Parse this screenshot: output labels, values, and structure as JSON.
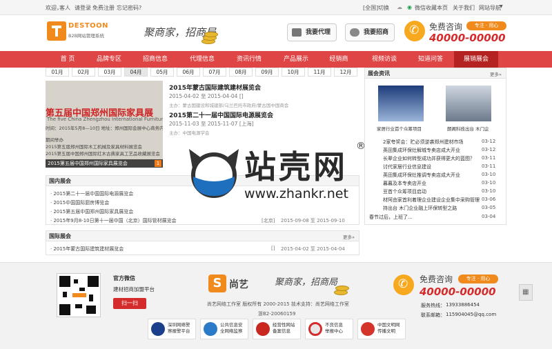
{
  "topbar": {
    "welcome": "欢迎，",
    "guest": "客人",
    "login": "请登录",
    "register": "免费注册",
    "forgot": "忘记密码?",
    "region": "[全国]",
    "switch": "切换",
    "weixin": "微信",
    "favorite": "收藏本页",
    "about": "关于我们",
    "sitenav": "网站导航"
  },
  "header": {
    "logo_text": "DESTOON",
    "logo_sub": "B2B网站管理系统",
    "slogan": "聚商家，招商局",
    "btn_agent": "我要代理",
    "btn_invite": "我要招商",
    "hotline_label": "免费咨询",
    "hotline_tag": "专注 · 用心",
    "hotline_number": "40000-00000"
  },
  "nav": {
    "items": [
      "首 页",
      "品牌专区",
      "招商信息",
      "代理信息",
      "资讯行情",
      "产品展示",
      "经销商",
      "视频访谈",
      "知道问答",
      "展销展会"
    ]
  },
  "months": [
    "01月",
    "02月",
    "03月",
    "04月",
    "05月",
    "06月",
    "07月",
    "08月",
    "09月",
    "10月",
    "11月",
    "12月"
  ],
  "slide": {
    "headline": "第五届中国郑州国际家具展",
    "english": "The five China Zhengzhou International Furniture",
    "line1": "时间：2015年5月8—10日  地址：郑州国际会展中心商务内",
    "line2": "期间举办",
    "line3": "2015第五届郑州国际木工机械及家具材料展览会",
    "line4": "2015第五届中国郑州国际红木古典家具工艺品收藏展览会",
    "caption": "2015第五届中国郑州国际家具展览会",
    "page": "1"
  },
  "events": [
    {
      "title": "2015年蒙古国际建筑建材展览会",
      "date": "2015-04-02 至 2015-04-04 []",
      "sub": "主办：蒙古国建设和城建部/乌兰巴托市政府/蒙古国中国商会"
    },
    {
      "title": "2015第二十一届中国国际电源展览会",
      "date": "2015-11-03 至 2015-11-07 [上海]",
      "sub": "主办：中国电源学会"
    }
  ],
  "domestic": {
    "title": "国内展会",
    "rows": [
      "· 2015第二十一届中国国际电源展览会",
      "· 2015中国国际厨房博览会",
      "· 2015第五届中国郑州国际家具展览会",
      "· 2015年9月8-10日第十一届中国（北京）国际管材展览会"
    ],
    "last_city": "[北京]",
    "last_date": "2015-09-08 至 2015-09-10"
  },
  "international": {
    "title": "国际展会",
    "more": "更多»",
    "rows": [
      "· 2015年蒙古国际建筑建材展览会"
    ],
    "city": "[]",
    "date": "2015-04-02 至 2015-04-04"
  },
  "news": {
    "title": "展会资讯",
    "more": "更多»",
    "pics": [
      {
        "label": "家居行业首个众筹项目"
      },
      {
        "label": "朗阁科技出台 木门企"
      }
    ],
    "rows": [
      {
        "text": "2家夸奖会：贮必须逆袭郑州建材市场",
        "date": "03-12"
      },
      {
        "text": "英田集成环保灶解城专卖店成大开业",
        "date": "03-12"
      },
      {
        "text": "长辈企业如何转型成功并获得更大的蓝图？",
        "date": "03-11"
      },
      {
        "text": "讨代家居行业信息建设",
        "date": "03-11"
      },
      {
        "text": "英田集成环保灶推调专卖店成大开业",
        "date": "03-10"
      },
      {
        "text": "暮暮及本专卖店开业",
        "date": "03-10"
      },
      {
        "text": "豆首个众筹项目启动",
        "date": "03-10"
      },
      {
        "text": "材阿由家首利着理企业建设企业集中采购管理",
        "date": "03-06"
      },
      {
        "text": "持出台 木门企业融上环保转型之路",
        "date": "03-05"
      },
      {
        "text": "春节过后，上班了...",
        "date": "03-04"
      }
    ]
  },
  "footer": {
    "wechat_title": "官方微信",
    "wechat_sub": "建材招商加盟平台",
    "scan": "扫一扫",
    "brand": "尚艺",
    "slogan": "聚商家，招商局",
    "copyright": "尚艺网络工作室 版权所有 2000-2015 技术支持：尚艺网络工作室",
    "icp": "浙B2-20060159",
    "hotline_label": "免费咨询",
    "hotline_tag": "专注 · 用心",
    "hotline_number": "40000-00000",
    "phone_label": "服务热线：",
    "phone": "13933886454",
    "email_label": "联系邮箱：",
    "email": "115904045@qq.com",
    "badges": [
      {
        "l1": "深圳网络警",
        "l2": "察报警平台"
      },
      {
        "l1": "公共信息安",
        "l2": "全网络监察"
      },
      {
        "l1": "经营性网站",
        "l2": "备案信息"
      },
      {
        "l1": "不良信息",
        "l2": "举报中心"
      },
      {
        "l1": "中国文明网",
        "l2": "传播文明"
      }
    ]
  },
  "watermark": {
    "cn": "站壳网",
    "url": "www.zhankr.net",
    "reg": "®"
  },
  "colors": {
    "nav_red": "#e04545",
    "nav_active": "#b52222",
    "orange": "#f08a1c",
    "hotline_red": "#d42c2c",
    "watermark_blue": "#1f6fbf"
  }
}
